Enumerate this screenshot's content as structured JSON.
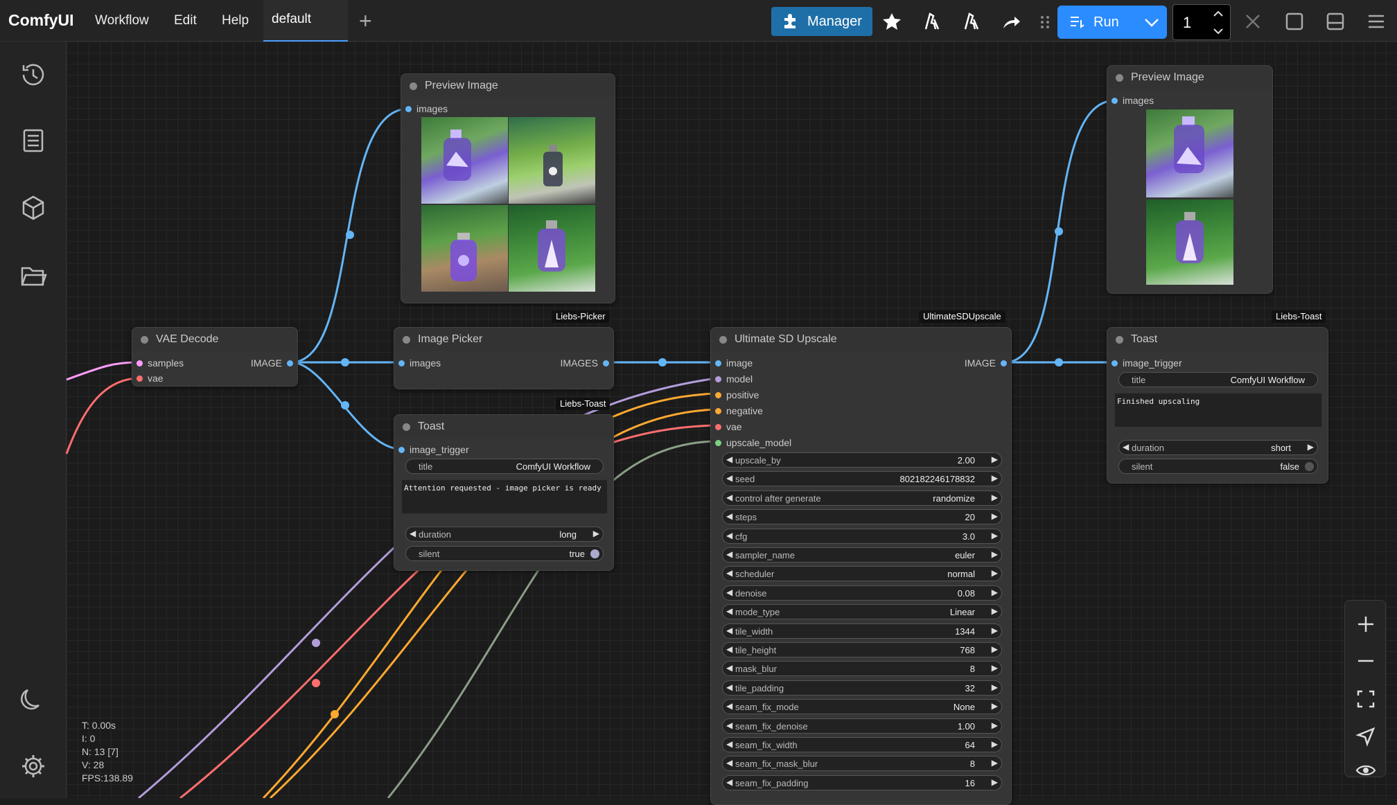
{
  "app": {
    "name": "ComfyUI"
  },
  "menu": [
    "Workflow",
    "Edit",
    "Help"
  ],
  "workflow_tab": "default",
  "toolbar": {
    "manager_label": "Manager",
    "run_label": "Run",
    "batch_count": "1"
  },
  "stats": {
    "t": "T: 0.00s",
    "i": "I: 0",
    "n": "N: 13 [7]",
    "v": "V: 28",
    "fps": "FPS:138.89"
  },
  "nodes": {
    "vae_decode": {
      "title": "VAE Decode",
      "inputs": [
        "samples",
        "vae"
      ],
      "output": "IMAGE"
    },
    "preview1": {
      "title": "Preview Image",
      "input": "images"
    },
    "image_picker": {
      "title": "Image Picker",
      "badge": "Liebs-Picker",
      "input": "images",
      "output": "IMAGES"
    },
    "toast1": {
      "title": "Toast",
      "badge": "Liebs-Toast",
      "input": "image_trigger",
      "title_widget": {
        "name": "title",
        "value": "ComfyUI Workflow"
      },
      "message": "Attention requested - image picker is ready",
      "duration": {
        "name": "duration",
        "value": "long"
      },
      "silent": {
        "name": "silent",
        "value": "true"
      }
    },
    "upscale": {
      "title": "Ultimate SD Upscale",
      "badge": "UltimateSDUpscale",
      "inputs": [
        "image",
        "model",
        "positive",
        "negative",
        "vae",
        "upscale_model"
      ],
      "output": "IMAGE",
      "widgets": [
        {
          "name": "upscale_by",
          "value": "2.00"
        },
        {
          "name": "seed",
          "value": "802182246178832"
        },
        {
          "name": "control after generate",
          "value": "randomize"
        },
        {
          "name": "steps",
          "value": "20"
        },
        {
          "name": "cfg",
          "value": "3.0"
        },
        {
          "name": "sampler_name",
          "value": "euler"
        },
        {
          "name": "scheduler",
          "value": "normal"
        },
        {
          "name": "denoise",
          "value": "0.08"
        },
        {
          "name": "mode_type",
          "value": "Linear"
        },
        {
          "name": "tile_width",
          "value": "1344"
        },
        {
          "name": "tile_height",
          "value": "768"
        },
        {
          "name": "mask_blur",
          "value": "8"
        },
        {
          "name": "tile_padding",
          "value": "32"
        },
        {
          "name": "seam_fix_mode",
          "value": "None"
        },
        {
          "name": "seam_fix_denoise",
          "value": "1.00"
        },
        {
          "name": "seam_fix_width",
          "value": "64"
        },
        {
          "name": "seam_fix_mask_blur",
          "value": "8"
        },
        {
          "name": "seam_fix_padding",
          "value": "16"
        }
      ]
    },
    "preview2": {
      "title": "Preview Image",
      "input": "images"
    },
    "toast2": {
      "title": "Toast",
      "badge": "Liebs-Toast",
      "input": "image_trigger",
      "title_widget": {
        "name": "title",
        "value": "ComfyUI Workflow"
      },
      "message": "Finished upscaling",
      "duration": {
        "name": "duration",
        "value": "short"
      },
      "silent": {
        "name": "silent",
        "value": "false"
      }
    }
  },
  "colors": {
    "image": "#64b5f6",
    "model": "#b39ddb",
    "conditioning": "#ffa931",
    "vae": "#ff6e6e",
    "latent": "#ff9cf9",
    "upscale_model": "#8a9e86",
    "accent": "#2b8cff"
  },
  "icons": {
    "sidebar": [
      "history-icon",
      "node-library-icon",
      "model-library-icon",
      "workflows-folder-icon",
      "theme-moon-icon",
      "settings-gear-icon"
    ],
    "toolbar": [
      "puzzle-icon",
      "star-icon",
      "comfy-logo-icon",
      "comfy-logo-icon",
      "share-icon",
      "drag-handle-icon",
      "queue-icon",
      "chevron-down-icon",
      "close-icon",
      "square-icon",
      "panel-icon",
      "hamburger-icon"
    ],
    "zoom": [
      "zoom-in-icon",
      "zoom-out-icon",
      "fit-view-icon",
      "locate-icon",
      "eye-icon"
    ]
  }
}
